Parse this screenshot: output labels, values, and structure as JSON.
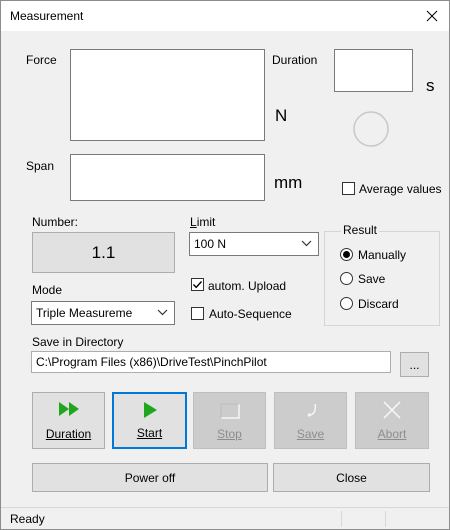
{
  "window": {
    "title": "Measurement"
  },
  "force": {
    "label": "Force",
    "unit": "N"
  },
  "duration": {
    "label": "Duration",
    "unit": "s"
  },
  "span": {
    "label": "Span",
    "unit": "mm"
  },
  "average_values": {
    "label": "Average values",
    "checked": false
  },
  "number": {
    "label": "Number:",
    "value": "1.1"
  },
  "limit": {
    "label": "Limit",
    "selected": "100 N"
  },
  "autom_upload": {
    "label": "autom. Upload",
    "checked": true
  },
  "auto_sequence": {
    "label": "Auto-Sequence",
    "checked": false
  },
  "mode": {
    "label": "Mode",
    "selected": "Triple Measureme"
  },
  "result": {
    "label": "Result",
    "options": [
      {
        "label": "Manually",
        "selected": true
      },
      {
        "label": "Save",
        "selected": false
      },
      {
        "label": "Discard",
        "selected": false
      }
    ]
  },
  "directory": {
    "label": "Save in Directory",
    "value": "C:\\Program Files (x86)\\DriveTest\\PinchPilot",
    "browse_label": "..."
  },
  "actions": {
    "duration": "Duration",
    "start": "Start",
    "stop": "Stop",
    "save": "Save",
    "abort": "Abort"
  },
  "bottom": {
    "power_off": "Power off",
    "close": "Close"
  },
  "status": {
    "text": "Ready"
  },
  "colors": {
    "accent": "#0078d7",
    "play_green": "#1fa61f",
    "disabled_text": "#8d8d8d"
  }
}
